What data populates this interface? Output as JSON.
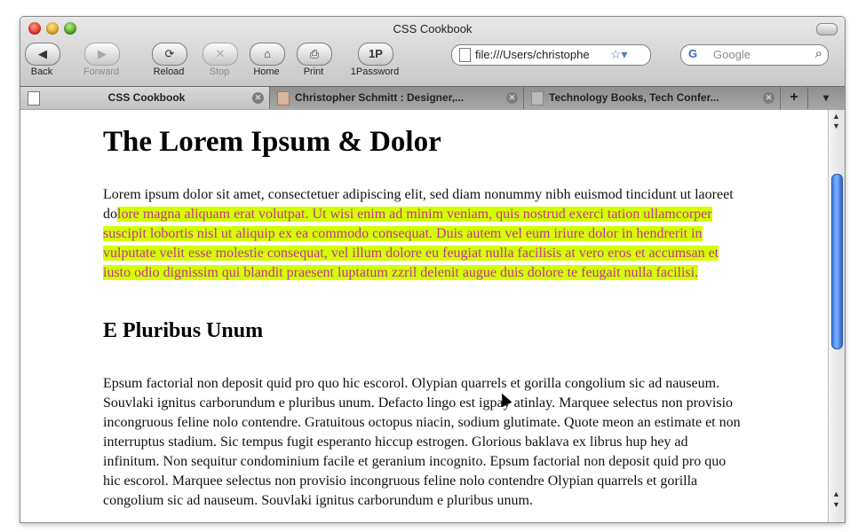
{
  "window": {
    "title": "CSS Cookbook"
  },
  "toolbar": {
    "buttons": [
      {
        "label": "Back",
        "glyph": "◀"
      },
      {
        "label": "Forward",
        "glyph": "▶"
      },
      {
        "label": "Reload",
        "glyph": "⟳"
      },
      {
        "label": "Stop",
        "glyph": "✕"
      },
      {
        "label": "Home",
        "glyph": "⌂"
      },
      {
        "label": "Print",
        "glyph": "⎙"
      },
      {
        "label": "1Password",
        "glyph": "1P"
      }
    ],
    "url": "file:///Users/christophe",
    "search_placeholder": "Google"
  },
  "tabs": [
    {
      "label": "CSS Cookbook",
      "active": true
    },
    {
      "label": "Christopher Schmitt : Designer,...",
      "active": false
    },
    {
      "label": "Technology Books, Tech Confer...",
      "active": false
    }
  ],
  "page": {
    "heading": "The Lorem Ipsum & Dolor",
    "para1_plain": "Lorem ipsum dolor sit amet, consectetuer adipiscing elit, sed diam nonummy nibh euismod tincidunt ut laoreet do",
    "para1_highlight": "lore magna aliquam erat volutpat. Ut wisi enim ad minim veniam, quis nostrud exerci tation ullamcorper suscipit lobortis nisl ut aliquip ex ea commodo consequat. Duis autem vel eum iriure dolor in hendrerit in vulputate velit esse molestie consequat, vel illum dolore eu feugiat nulla facilisis at vero eros et accumsan et iusto odio dignissim qui blandit praesent luptatum zzril delenit augue duis dolore te feugait nulla facilisi.",
    "subheading": "E Pluribus Unum",
    "para2": "Epsum factorial non deposit quid pro quo hic escorol. Olypian quarrels et gorilla congolium sic ad nauseum. Souvlaki ignitus carborundum e pluribus unum. Defacto lingo est igpay atinlay. Marquee selectus non provisio incongruous feline nolo contendre. Gratuitous octopus niacin, sodium glutimate. Quote meon an estimate et non interruptus stadium. Sic tempus fugit esperanto hiccup estrogen. Glorious baklava ex librus hup hey ad infinitum. Non sequitur condominium facile et geranium incognito. Epsum factorial non deposit quid pro quo hic escorol. Marquee selectus non provisio incongruous feline nolo contendre Olypian quarrels et gorilla congolium sic ad nauseum. Souvlaki ignitus carborundum e pluribus unum."
  },
  "colors": {
    "highlight_bg": "#d4ff00",
    "highlight_text": "#c0349a"
  }
}
